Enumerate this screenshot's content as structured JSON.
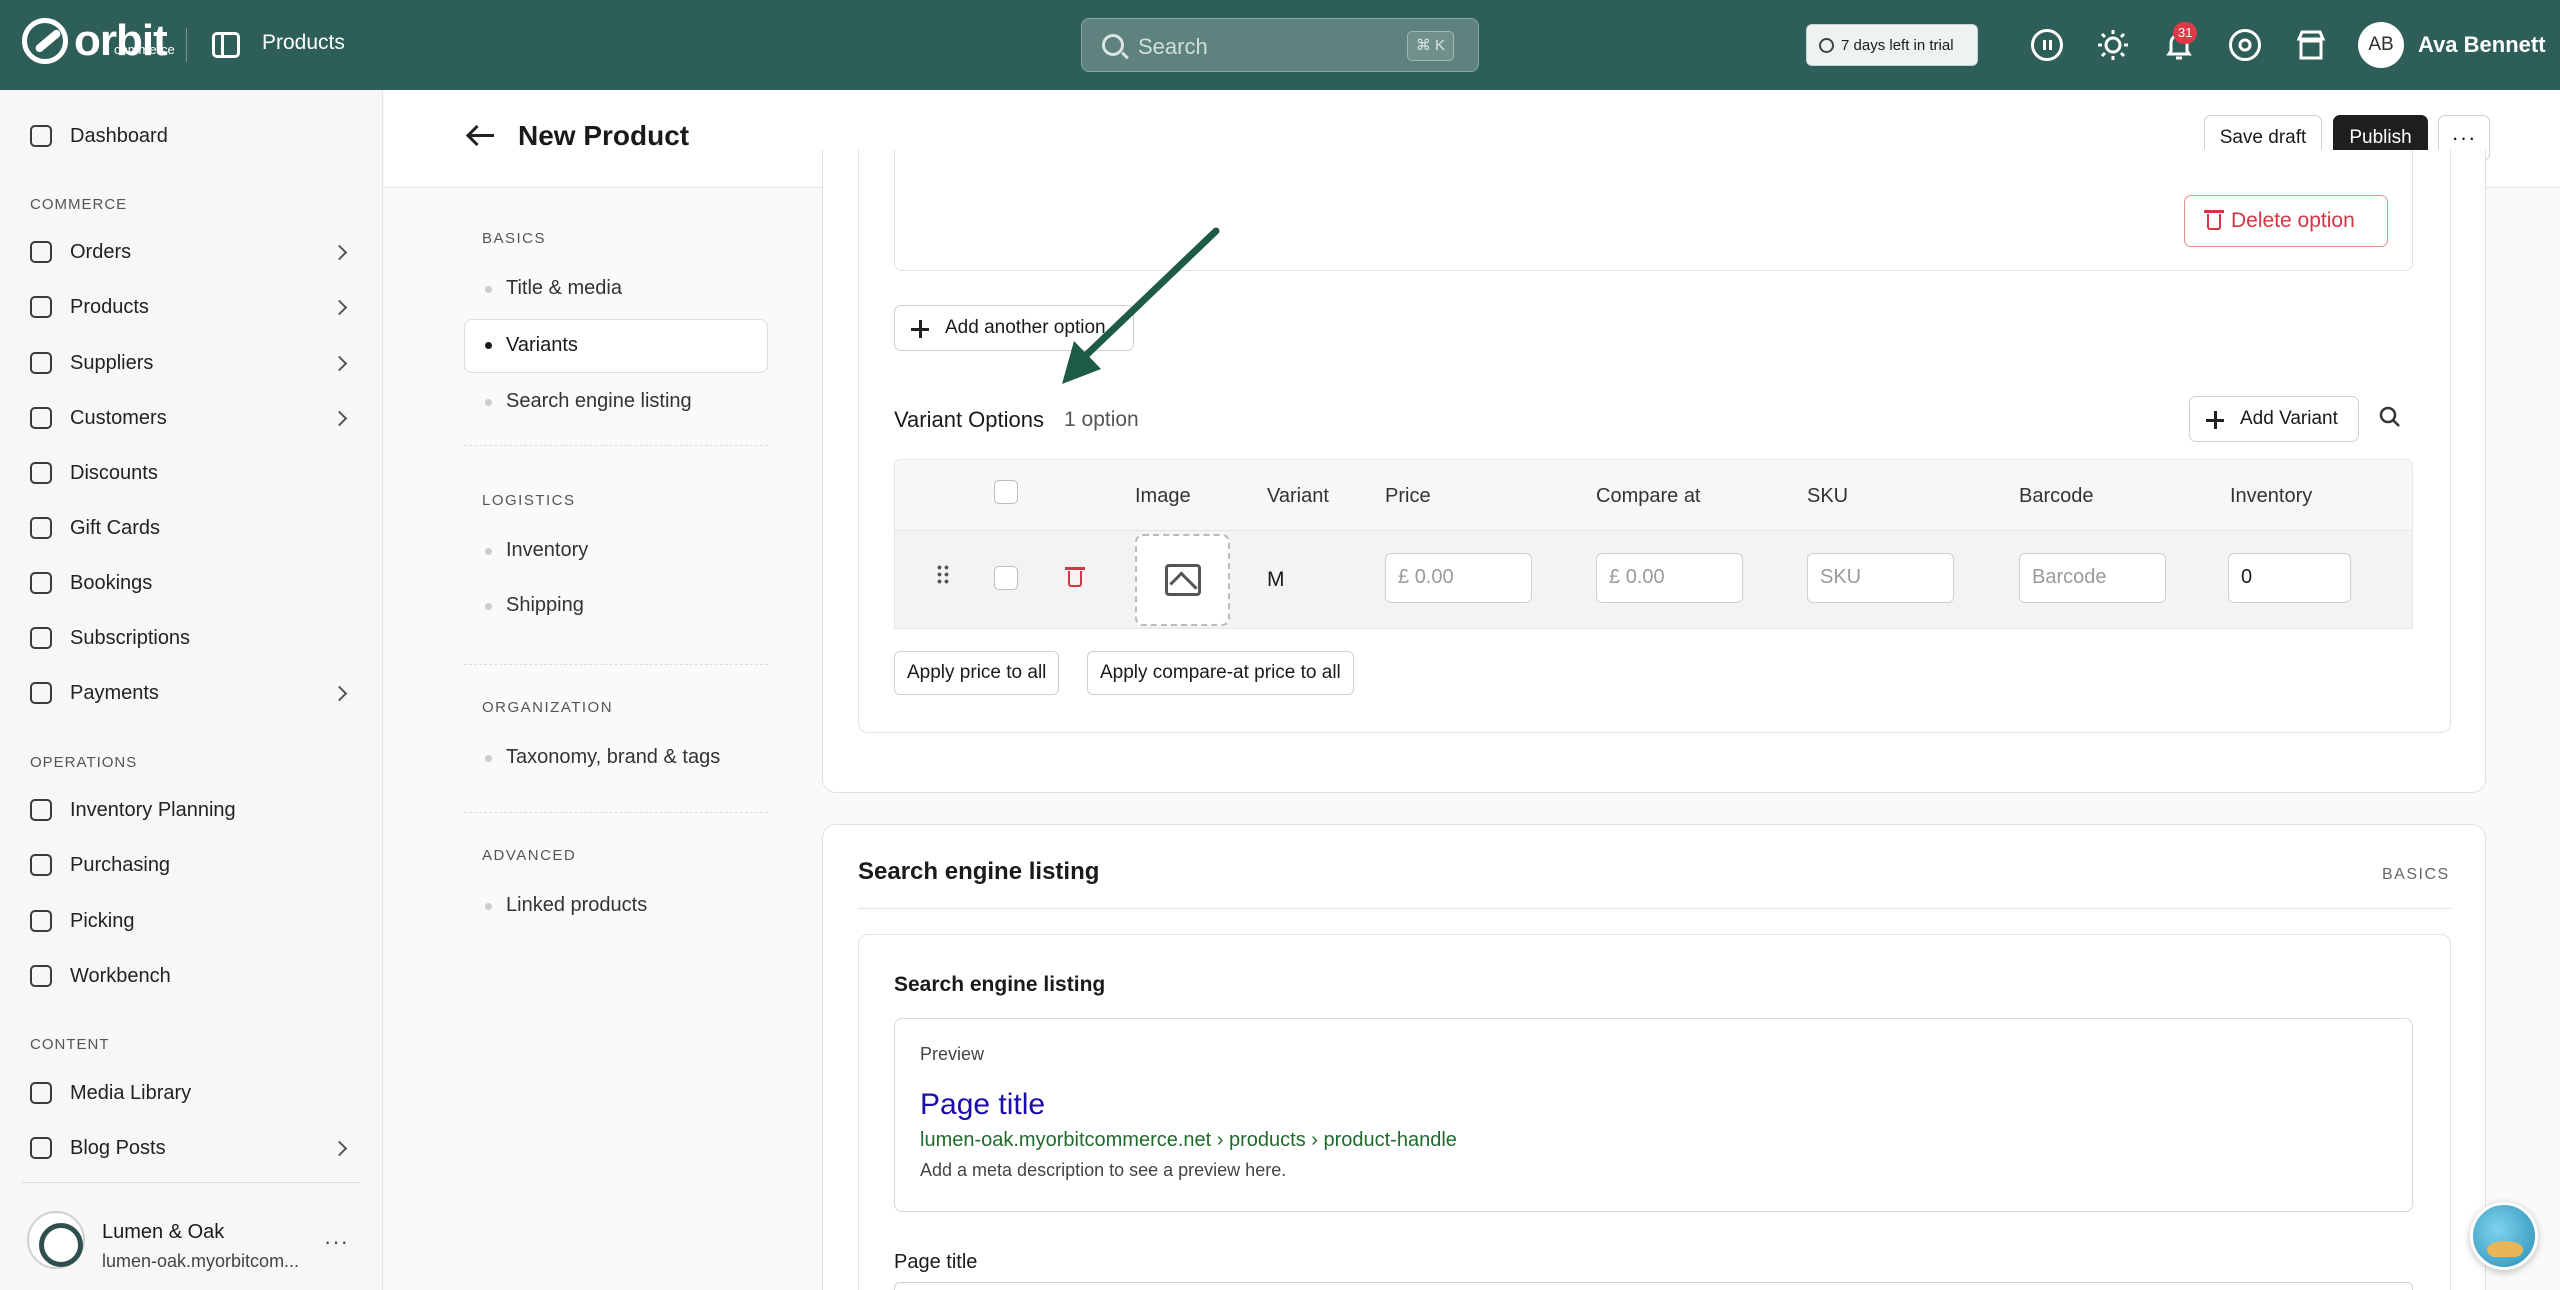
{
  "topbar": {
    "brand": "orbit",
    "brand_sub": "commerce",
    "section_title": "Products",
    "search_placeholder": "Search",
    "search_shortcut": "⌘ K",
    "trial_text": "7 days left in trial",
    "notification_count": "31",
    "avatar_initials": "AB",
    "user_name": "Ava Bennett"
  },
  "sidebar": {
    "items": [
      {
        "label": "Dashboard"
      },
      {
        "label": "Orders"
      },
      {
        "label": "Products"
      },
      {
        "label": "Suppliers"
      },
      {
        "label": "Customers"
      },
      {
        "label": "Discounts"
      },
      {
        "label": "Gift Cards"
      },
      {
        "label": "Bookings"
      },
      {
        "label": "Subscriptions"
      },
      {
        "label": "Payments"
      },
      {
        "label": "Inventory Planning"
      },
      {
        "label": "Purchasing"
      },
      {
        "label": "Picking"
      },
      {
        "label": "Workbench"
      },
      {
        "label": "Media Library"
      },
      {
        "label": "Blog Posts"
      }
    ],
    "sections": [
      "COMMERCE",
      "OPERATIONS",
      "CONTENT"
    ],
    "store_name": "Lumen & Oak",
    "store_url": "lumen-oak.myorbitcom..."
  },
  "header": {
    "title": "New Product",
    "save_draft": "Save draft",
    "publish": "Publish"
  },
  "section_nav": {
    "groups": [
      {
        "heading": "BASICS",
        "items": [
          "Title & media",
          "Variants",
          "Search engine listing"
        ]
      },
      {
        "heading": "LOGISTICS",
        "items": [
          "Inventory",
          "Shipping"
        ]
      },
      {
        "heading": "ORGANIZATION",
        "items": [
          "Taxonomy, brand & tags"
        ]
      },
      {
        "heading": "ADVANCED",
        "items": [
          "Linked products"
        ]
      }
    ],
    "active": "Variants"
  },
  "variants": {
    "delete_option": "Delete option",
    "add_another_option": "Add another option",
    "title": "Variant Options",
    "count": "1 option",
    "add_variant": "Add Variant",
    "columns": [
      "Image",
      "Variant",
      "Price",
      "Compare at",
      "SKU",
      "Barcode",
      "Inventory"
    ],
    "rows": [
      {
        "variant": "M",
        "price_currency": "£",
        "price_placeholder": "0.00",
        "compare_currency": "£",
        "compare_placeholder": "0.00",
        "sku_placeholder": "SKU",
        "barcode_placeholder": "Barcode",
        "inventory": "0"
      }
    ],
    "apply_price": "Apply price to all",
    "apply_compare": "Apply compare-at price to all"
  },
  "seo": {
    "card_title": "Search engine listing",
    "card_tag": "BASICS",
    "inner_title": "Search engine listing",
    "preview_label": "Preview",
    "preview_title": "Page title",
    "preview_url": "lumen-oak.myorbitcommerce.net › products › product-handle",
    "preview_desc": "Add a meta description to see a preview here.",
    "page_title_label": "Page title"
  },
  "colors": {
    "topbar": "#2e5e58",
    "accent_green": "#1f5e4c",
    "danger": "#d63344",
    "link_blue": "#1a0dab",
    "url_green": "#1e6b2c"
  }
}
